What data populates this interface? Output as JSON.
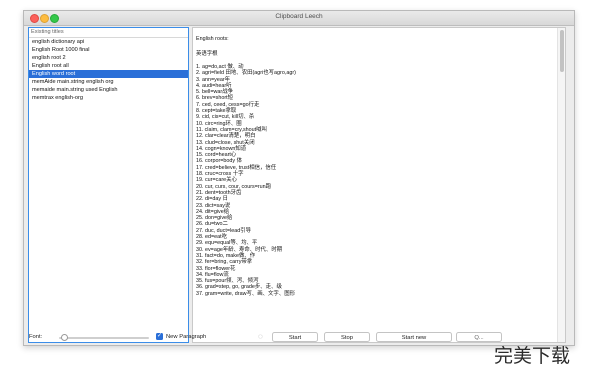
{
  "window": {
    "title": "Clipboard Leech"
  },
  "list": {
    "header": "Existing titles",
    "items": [
      {
        "label": "english dictionary api",
        "selected": false
      },
      {
        "label": "English Root 1000 final",
        "selected": false
      },
      {
        "label": "english root 2",
        "selected": false
      },
      {
        "label": "English root all",
        "selected": false
      },
      {
        "label": "English word root",
        "selected": true
      },
      {
        "label": "memAide main.string english org",
        "selected": false
      },
      {
        "label": "memaide main.string used English",
        "selected": false
      },
      {
        "label": "memtrax english-org",
        "selected": false
      }
    ]
  },
  "text": {
    "heading": "English roots:",
    "subheading": "英语字根",
    "lines": [
      "1. ag=do,act 做、动",
      "2. agri=field 田地、农田(agri也写agro,agr)",
      "3. ann=year年",
      "4. audi=hear听",
      "5. bell=war战争",
      "6. brev=short短",
      "7. ced, ceed, cess=go行走",
      "8. cept=take拿取",
      "9. cid, cis=cut, kill切、杀",
      "10. circ=ring环、圈",
      "11. claim, clam=cry,shout喊叫",
      "12. clar=clear清楚，明白",
      "13. clud=close, shut关闭",
      "14. cogn=known知道",
      "15. cord=heart心",
      "16. corpor=body 体",
      "17. cred=believe, trust相信，信任",
      "18. cruc=cross 十字",
      "19. cur=care关心",
      "20. cur, curs, cour, cours=run跑",
      "21. dent=tooth牙齿",
      "22. di=day 日",
      "23. dict=say说",
      "24. dit=give给",
      "25. don=give给",
      "26. du=two二",
      "27. duc, duct=lead引导",
      "28. ed=eat吃",
      "29. equ=equal等、均、平",
      "30. ev=age年龄、寿命、时代、时期",
      "31. fact=do, make做、作",
      "32. fer=bring, carry带拿",
      "33. flor=flower花",
      "34. flu=flow流",
      "35. fus=pour倾、泻、倾泻",
      "36. grad=step, go, grade步、走、级",
      "37. gram=write, draw写、画、文字、图形"
    ]
  },
  "bottom": {
    "font_label": "Font:",
    "checkbox_label": "New Paragraph",
    "checkbox_checked": true,
    "start": "Start",
    "stop": "Stop",
    "start_new": "Start new",
    "more": "Q..."
  },
  "watermark": {
    "text": "完美下载"
  },
  "colors": {
    "selection": "#2a6fd8",
    "focus_ring": "#3b8de8"
  }
}
